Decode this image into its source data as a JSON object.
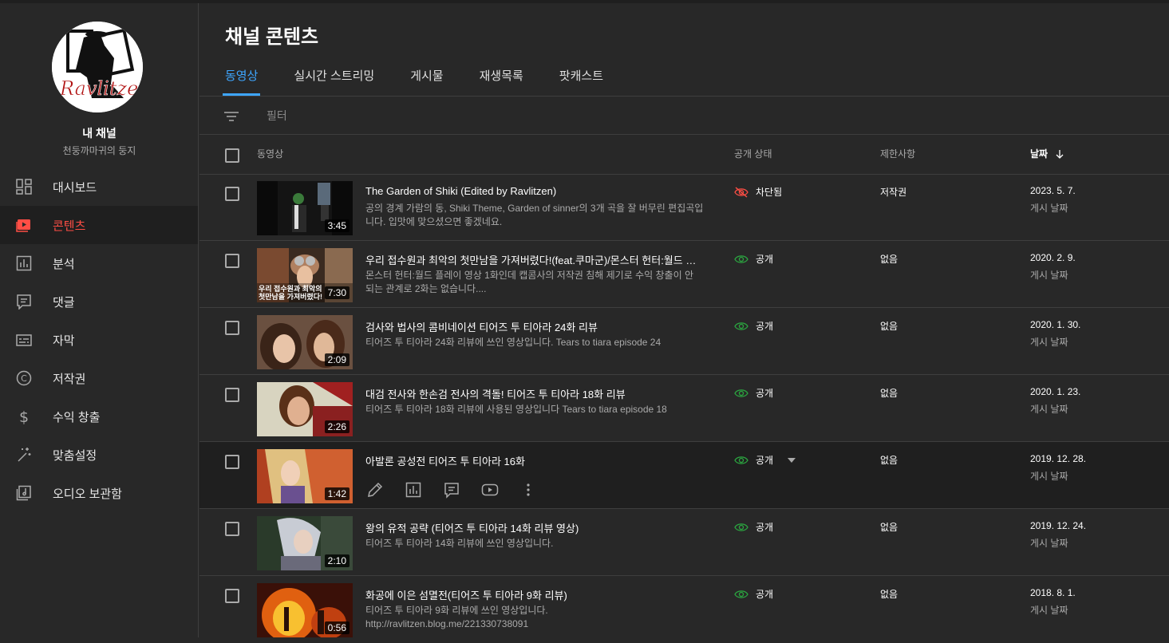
{
  "sidebar": {
    "channel_label": "내 채널",
    "channel_name": "천둥까마귀의 둥지",
    "avatar_text": "Ravlitzen",
    "items": [
      {
        "label": "대시보드",
        "icon": "dashboard-icon"
      },
      {
        "label": "콘텐츠",
        "icon": "content-icon",
        "active": true
      },
      {
        "label": "분석",
        "icon": "analytics-icon"
      },
      {
        "label": "댓글",
        "icon": "comments-icon"
      },
      {
        "label": "자막",
        "icon": "subtitles-icon"
      },
      {
        "label": "저작권",
        "icon": "copyright-icon"
      },
      {
        "label": "수익 창출",
        "icon": "dollar-icon"
      },
      {
        "label": "맞춤설정",
        "icon": "magic-wand-icon"
      },
      {
        "label": "오디오 보관함",
        "icon": "audio-library-icon"
      }
    ]
  },
  "main": {
    "title": "채널 콘텐츠",
    "tabs": [
      "동영상",
      "실시간 스트리밍",
      "게시물",
      "재생목록",
      "팟캐스트"
    ],
    "filter_placeholder": "필터",
    "columns": {
      "video": "동영상",
      "visibility": "공개 상태",
      "restrictions": "제한사항",
      "date": "날짜"
    }
  },
  "rows": [
    {
      "title": "The Garden of Shiki (Edited by Ravlitzen)",
      "desc": "공의 경계 가람의 동, Shiki Theme, Garden of sinner의 3개 곡을 잘 버무린 편집곡입니다. 입맛에 맞으셨으면 좋겠네요.",
      "duration": "3:45",
      "visibility": "차단됨",
      "restriction": "저작권",
      "date": "2023. 5. 7.",
      "date_label": "게시 날짜"
    },
    {
      "title": "우리 접수원과 최악의 첫만남을 가져버렸다!(feat.쿠마군)/몬스터 헌터:월드 플레이 영상",
      "desc": "몬스터 헌터:월드 플레이 영상 1화인데 캡콤사의 저작권 침해 제기로 수익 창출이 안 되는 관계로 2화는 없습니다....",
      "duration": "7:30",
      "visibility": "공개",
      "restriction": "없음",
      "date": "2020. 2. 9.",
      "date_label": "게시 날짜"
    },
    {
      "title": "검사와 법사의 콤비네이션 티어즈 투 티아라 24화 리뷰",
      "desc": "티어즈 투 티아라 24화 리뷰에 쓰인 영상입니다. Tears to tiara episode 24",
      "duration": "2:09",
      "visibility": "공개",
      "restriction": "없음",
      "date": "2020. 1. 30.",
      "date_label": "게시 날짜"
    },
    {
      "title": "대검 전사와 한손검 전사의 격돌! 티어즈 투 티아라 18화 리뷰",
      "desc": "티어즈 투 티아라 18화 리뷰에 사용된 영상입니다 Tears to tiara episode 18",
      "duration": "2:26",
      "visibility": "공개",
      "restriction": "없음",
      "date": "2020. 1. 23.",
      "date_label": "게시 날짜"
    },
    {
      "title": "아발론 공성전 티어즈 투 티아라 16화",
      "desc": "",
      "duration": "1:42",
      "visibility": "공개",
      "restriction": "없음",
      "date": "2019. 12. 28.",
      "date_label": "게시 날짜"
    },
    {
      "title": "왕의 유적 공략 (티어즈 투 티아라 14화 리뷰 영상)",
      "desc": "티어즈 투 티아라 14화 리뷰에 쓰인 영상입니다.",
      "duration": "2:10",
      "visibility": "공개",
      "restriction": "없음",
      "date": "2019. 12. 24.",
      "date_label": "게시 날짜"
    },
    {
      "title": "화공에 이은 섬멸전(티어즈 투 티아라 9화 리뷰)",
      "desc": "티어즈 투 티아라 9화 리뷰에 쓰인 영상입니다. http://ravlitzen.blog.me/221330738091",
      "duration": "0:56",
      "visibility": "공개",
      "restriction": "없음",
      "date": "2018. 8. 1.",
      "date_label": "게시 날짜"
    }
  ],
  "thumb_overlay": {
    "row2_caption": "우리 접수원과 최악의 첫만남을 가져버렸다!"
  },
  "colors": {
    "accent_blue": "#3ea6ff",
    "active_red": "#ff4e45",
    "public_green": "#2ba640",
    "blocked_red": "#ff4e45"
  }
}
